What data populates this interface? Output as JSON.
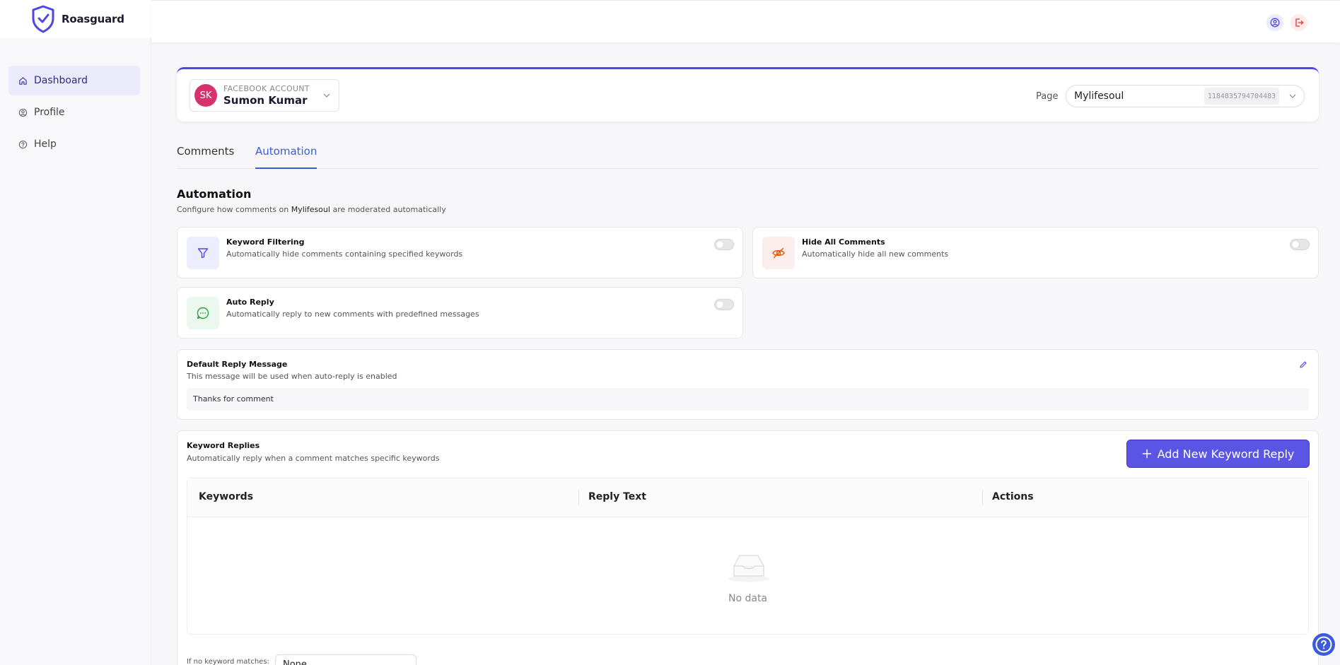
{
  "app": {
    "name": "Roasguard"
  },
  "sidebar": {
    "items": [
      {
        "label": "Dashboard",
        "icon": "home-icon",
        "active": true
      },
      {
        "label": "Profile",
        "icon": "user-icon",
        "active": false
      },
      {
        "label": "Help",
        "icon": "help-circle-icon",
        "active": false
      }
    ]
  },
  "account": {
    "label": "FACEBOOK ACCOUNT",
    "name": "Sumon Kumar",
    "initials": "SK",
    "page_label": "Page",
    "page_name": "Mylifesoul",
    "page_id": "1184835794704483"
  },
  "tabs": [
    {
      "label": "Comments",
      "active": false
    },
    {
      "label": "Automation",
      "active": true
    }
  ],
  "automation": {
    "title": "Automation",
    "subtitle_prefix": "Configure how comments on ",
    "subtitle_page": "Mylifesoul",
    "subtitle_suffix": " are moderated automatically",
    "features": [
      {
        "title": "Keyword Filtering",
        "description": "Automatically hide comments containing specified keywords",
        "enabled": false
      },
      {
        "title": "Hide All Comments",
        "description": "Automatically hide all new comments",
        "enabled": false
      },
      {
        "title": "Auto Reply",
        "description": "Automatically reply to new comments with predefined messages",
        "enabled": false
      }
    ]
  },
  "default_reply": {
    "title": "Default Reply Message",
    "subtitle": "This message will be used when auto-reply is enabled",
    "message": "Thanks for comment"
  },
  "keyword_replies": {
    "title": "Keyword Replies",
    "subtitle": "Automatically reply when a comment matches specific keywords",
    "add_button": "Add New Keyword Reply",
    "columns": [
      "Keywords",
      "Reply Text",
      "Actions"
    ],
    "rows": [],
    "empty_text": "No data",
    "no_match_label": "If no keyword matches:",
    "no_match_value": "None"
  },
  "colors": {
    "accent": "#4f46e5",
    "tab_active": "#3b5bdb",
    "button": "#5b55e6"
  }
}
